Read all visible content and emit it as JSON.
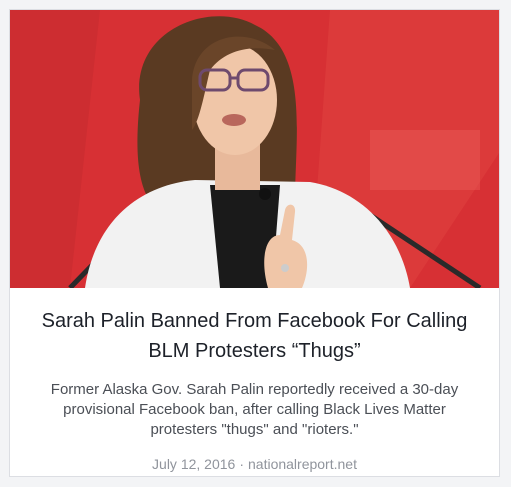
{
  "link_preview": {
    "headline": "Sarah Palin Banned From Facebook For Calling BLM Protesters “Thugs”",
    "summary": "Former Alaska Gov. Sarah Palin reportedly received a 30-day provisional Facebook ban, after calling Black Lives Matter protesters \"thugs\" and \"rioters.\"",
    "date": "July 12, 2016",
    "separator": "·",
    "domain": "nationalreport.net"
  },
  "image": {
    "subject": "woman-speaking-at-podium",
    "background_color": "#d73034",
    "jacket_color": "#f2f2f2",
    "blouse_color": "#1a1a1a",
    "hair_color": "#5a3a22"
  }
}
